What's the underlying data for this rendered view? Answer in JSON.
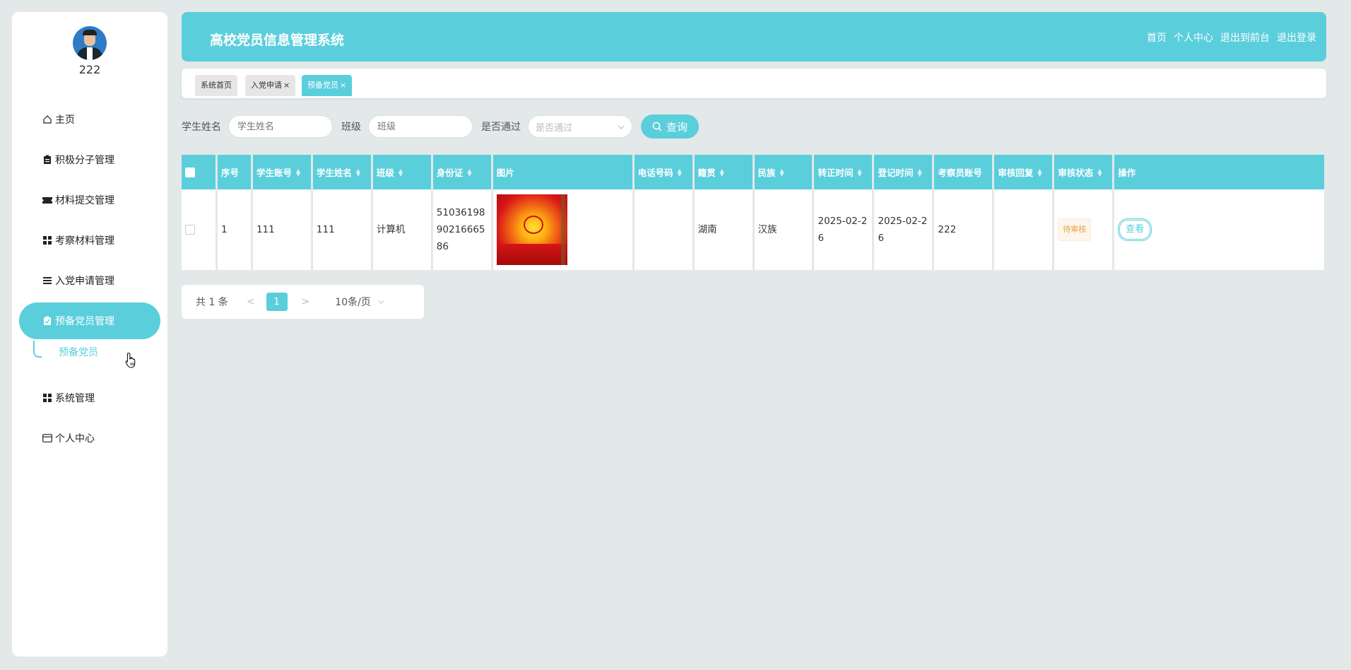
{
  "user": {
    "name": "222"
  },
  "sidebar": {
    "items": [
      {
        "label": "主页",
        "icon": "home-icon"
      },
      {
        "label": "积极分子管理",
        "icon": "clipboard-icon"
      },
      {
        "label": "材料提交管理",
        "icon": "ticket-icon"
      },
      {
        "label": "考察材料管理",
        "icon": "grid-icon"
      },
      {
        "label": "入党申请管理",
        "icon": "list-icon"
      },
      {
        "label": "预备党员管理",
        "icon": "clipboard-check-icon"
      },
      {
        "label": "系统管理",
        "icon": "grid-icon"
      },
      {
        "label": "个人中心",
        "icon": "card-icon"
      }
    ],
    "submenu_label": "预备党员"
  },
  "header": {
    "title": "高校党员信息管理系统",
    "links": [
      "首页",
      "个人中心",
      "退出到前台",
      "退出登录"
    ]
  },
  "tabs": [
    {
      "label": "系统首页"
    },
    {
      "label": "入党申请"
    },
    {
      "label": "预备党员"
    }
  ],
  "tab_close": "×",
  "search": {
    "name_label": "学生姓名",
    "name_placeholder": "学生姓名",
    "class_label": "班级",
    "class_placeholder": "班级",
    "pass_label": "是否通过",
    "pass_placeholder": "是否通过",
    "button_label": "查询"
  },
  "table": {
    "columns": [
      "序号",
      "学生账号",
      "学生姓名",
      "班级",
      "身份证",
      "图片",
      "电话号码",
      "籍贯",
      "民族",
      "转正时间",
      "登记时间",
      "考察员账号",
      "审核回复",
      "审核状态",
      "操作"
    ],
    "rows": [
      {
        "index": "1",
        "account": "111",
        "name": "111",
        "class": "计算机",
        "id_card": "510361989021666586",
        "image": "party-flag-image",
        "phone": "",
        "native_place": "湖南",
        "ethnicity": "汉族",
        "regular_time": "2025-02-26",
        "register_time": "2025-02-26",
        "inspector": "222",
        "reply": "",
        "status": "待审核",
        "action": "查看"
      }
    ]
  },
  "pagination": {
    "total": "共 1 条",
    "prev": "<",
    "current": "1",
    "next": ">",
    "page_size": "10条/页"
  },
  "colors": {
    "accent": "#5bcedc",
    "background": "#e3e8e8",
    "warning": "#e6a23c"
  }
}
